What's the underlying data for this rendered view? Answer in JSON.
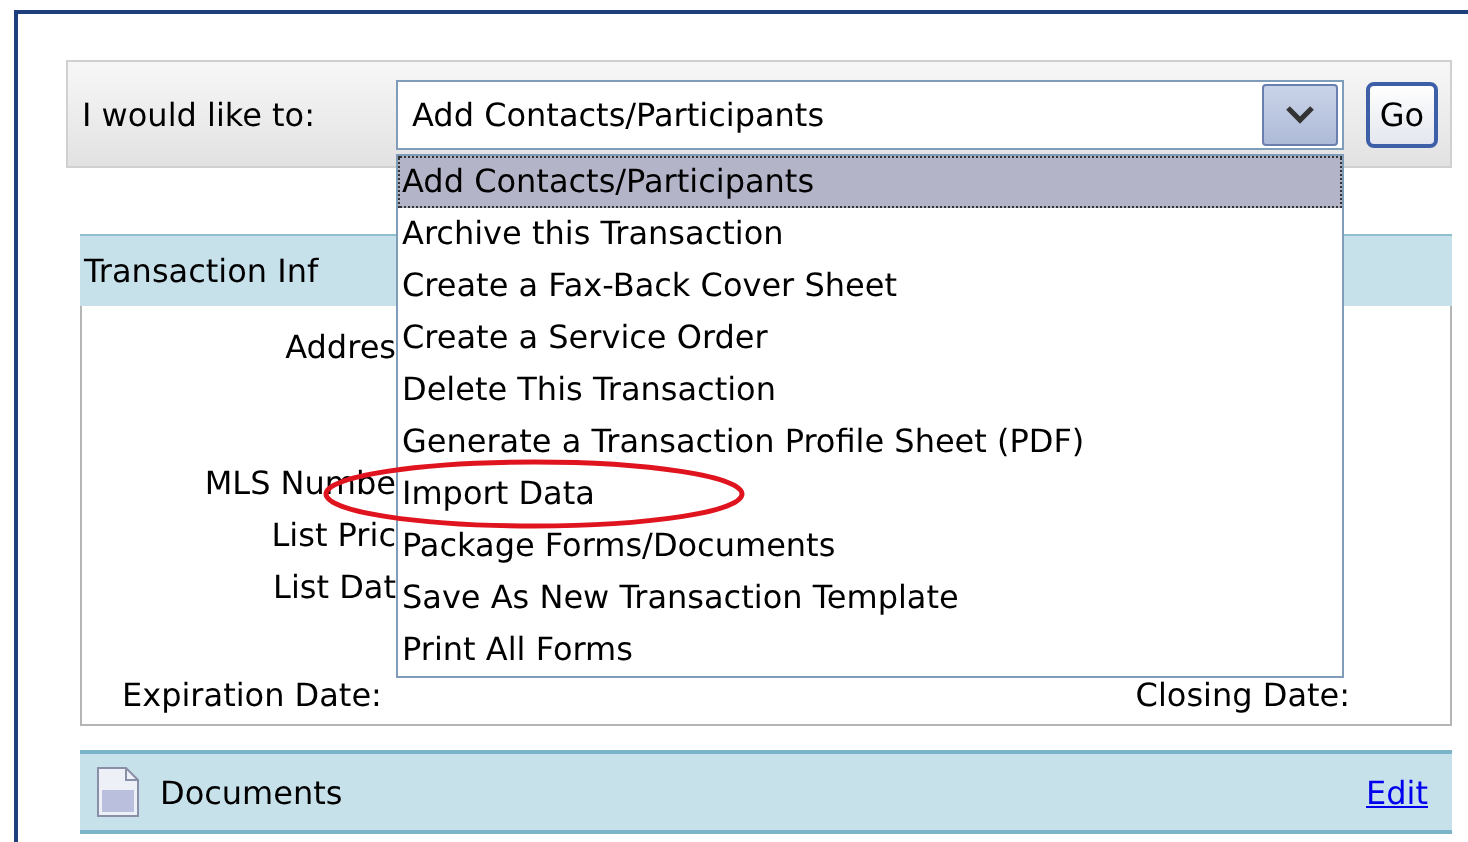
{
  "toolbar": {
    "label": "I would like to:",
    "select": {
      "value": "Add Contacts/Participants",
      "expanded": true
    },
    "go_button": "Go"
  },
  "dropdown": {
    "items": [
      {
        "label": "Add Contacts/Participants",
        "selected": true,
        "circled": false
      },
      {
        "label": "Archive this Transaction",
        "selected": false,
        "circled": false
      },
      {
        "label": "Create a Fax-Back Cover Sheet",
        "selected": false,
        "circled": false
      },
      {
        "label": "Create a Service Order",
        "selected": false,
        "circled": false
      },
      {
        "label": "Delete This Transaction",
        "selected": false,
        "circled": false
      },
      {
        "label": "Generate a Transaction Profile Sheet (PDF)",
        "selected": false,
        "circled": false
      },
      {
        "label": "Import Data",
        "selected": false,
        "circled": true
      },
      {
        "label": "Package Forms/Documents",
        "selected": false,
        "circled": false
      },
      {
        "label": "Save As New Transaction Template",
        "selected": false,
        "circled": false
      },
      {
        "label": "Print All Forms",
        "selected": false,
        "circled": false
      }
    ]
  },
  "transaction_panel": {
    "title": "Transaction Inf",
    "fields": [
      "Addres",
      "MLS Numbe",
      "List Pric",
      "List Dat"
    ],
    "footer_fields": [
      "Expiration Date:",
      "Closing Date:"
    ]
  },
  "documents_bar": {
    "title": "Documents",
    "link": "Edit"
  }
}
